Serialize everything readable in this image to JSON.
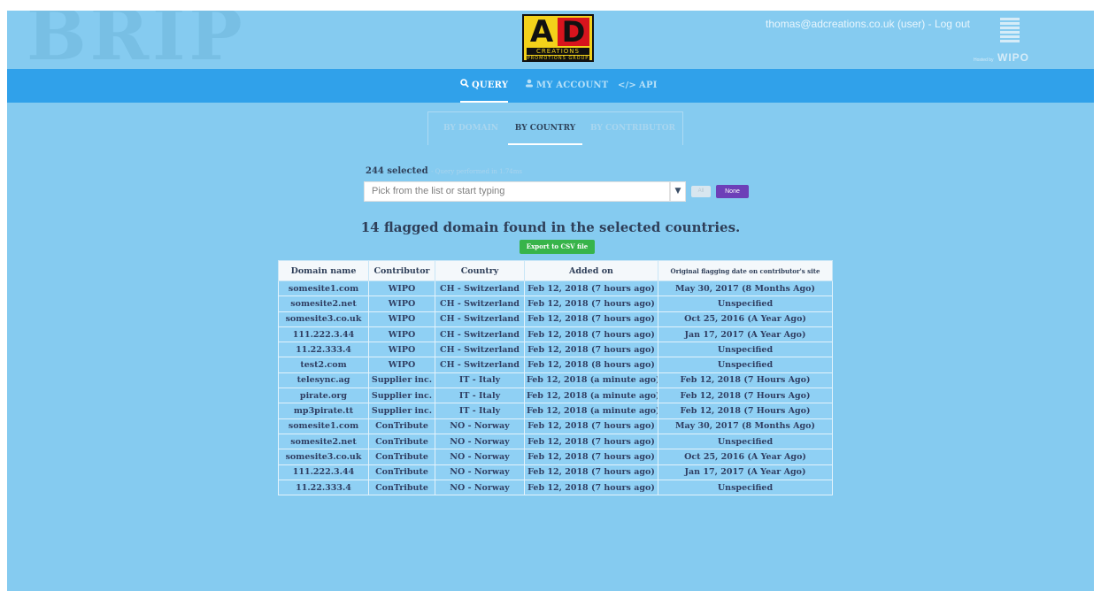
{
  "header": {
    "brand": "BRIP",
    "logo": {
      "letters": "AD",
      "line1": "CREATIONS",
      "line2": "PROMOTIONS GROUP",
      "colors": {
        "background": "#f3d21a",
        "accent": "#d8141d"
      }
    },
    "user_text": "thomas@adcreations.co.uk (user) -",
    "logout_label": "Log out",
    "wipo": {
      "small": "Hosted by",
      "name": "WIPO"
    }
  },
  "nav": [
    {
      "label": "QUERY",
      "icon": "search-icon",
      "active": true
    },
    {
      "label": "MY ACCOUNT",
      "icon": "user-icon",
      "active": false
    },
    {
      "label": "API",
      "icon": "code-icon",
      "active": false
    }
  ],
  "tabs": [
    {
      "label": "BY DOMAIN",
      "active": false
    },
    {
      "label": "BY COUNTRY",
      "active": true
    },
    {
      "label": "BY CONTRIBUTOR",
      "active": false
    }
  ],
  "query": {
    "selected_count": "244 selected",
    "performance": "- Query performed in 1.74ms",
    "placeholder": "Pick from the list or start typing",
    "all_label": "All",
    "none_label": "None"
  },
  "results": {
    "heading": "14 flagged domain found in the selected countries.",
    "export_label": "Export to CSV file"
  },
  "table": {
    "columns": [
      "Domain name",
      "Contributor",
      "Country",
      "Added on",
      "Original flagging date on contributor's site"
    ],
    "rows": [
      [
        "somesite1.com",
        "WIPO",
        "CH - Switzerland",
        "Feb 12, 2018 (7 hours ago)",
        "May 30, 2017 (8 Months Ago)"
      ],
      [
        "somesite2.net",
        "WIPO",
        "CH - Switzerland",
        "Feb 12, 2018 (7 hours ago)",
        "Unspecified"
      ],
      [
        "somesite3.co.uk",
        "WIPO",
        "CH - Switzerland",
        "Feb 12, 2018 (7 hours ago)",
        "Oct 25, 2016 (A Year Ago)"
      ],
      [
        "111.222.3.44",
        "WIPO",
        "CH - Switzerland",
        "Feb 12, 2018 (7 hours ago)",
        "Jan 17, 2017 (A Year Ago)"
      ],
      [
        "11.22.333.4",
        "WIPO",
        "CH - Switzerland",
        "Feb 12, 2018 (7 hours ago)",
        "Unspecified"
      ],
      [
        "test2.com",
        "WIPO",
        "CH - Switzerland",
        "Feb 12, 2018 (8 hours ago)",
        "Unspecified"
      ],
      [
        "telesync.ag",
        "Supplier inc.",
        "IT - Italy",
        "Feb 12, 2018 (a minute ago)",
        "Feb 12, 2018 (7 Hours Ago)"
      ],
      [
        "pirate.org",
        "Supplier inc.",
        "IT - Italy",
        "Feb 12, 2018 (a minute ago)",
        "Feb 12, 2018 (7 Hours Ago)"
      ],
      [
        "mp3pirate.tt",
        "Supplier inc.",
        "IT - Italy",
        "Feb 12, 2018 (a minute ago)",
        "Feb 12, 2018 (7 Hours Ago)"
      ],
      [
        "somesite1.com",
        "ConTribute",
        "NO - Norway",
        "Feb 12, 2018 (7 hours ago)",
        "May 30, 2017 (8 Months Ago)"
      ],
      [
        "somesite2.net",
        "ConTribute",
        "NO - Norway",
        "Feb 12, 2018 (7 hours ago)",
        "Unspecified"
      ],
      [
        "somesite3.co.uk",
        "ConTribute",
        "NO - Norway",
        "Feb 12, 2018 (7 hours ago)",
        "Oct 25, 2016 (A Year Ago)"
      ],
      [
        "111.222.3.44",
        "ConTribute",
        "NO - Norway",
        "Feb 12, 2018 (7 hours ago)",
        "Jan 17, 2017 (A Year Ago)"
      ],
      [
        "11.22.333.4",
        "ConTribute",
        "NO - Norway",
        "Feb 12, 2018 (7 hours ago)",
        "Unspecified"
      ]
    ]
  },
  "colors": {
    "page_background": "#85cbf0",
    "navbar": "#30a1ea",
    "export_button": "#37b44a",
    "none_button": "#6d3fb8"
  }
}
